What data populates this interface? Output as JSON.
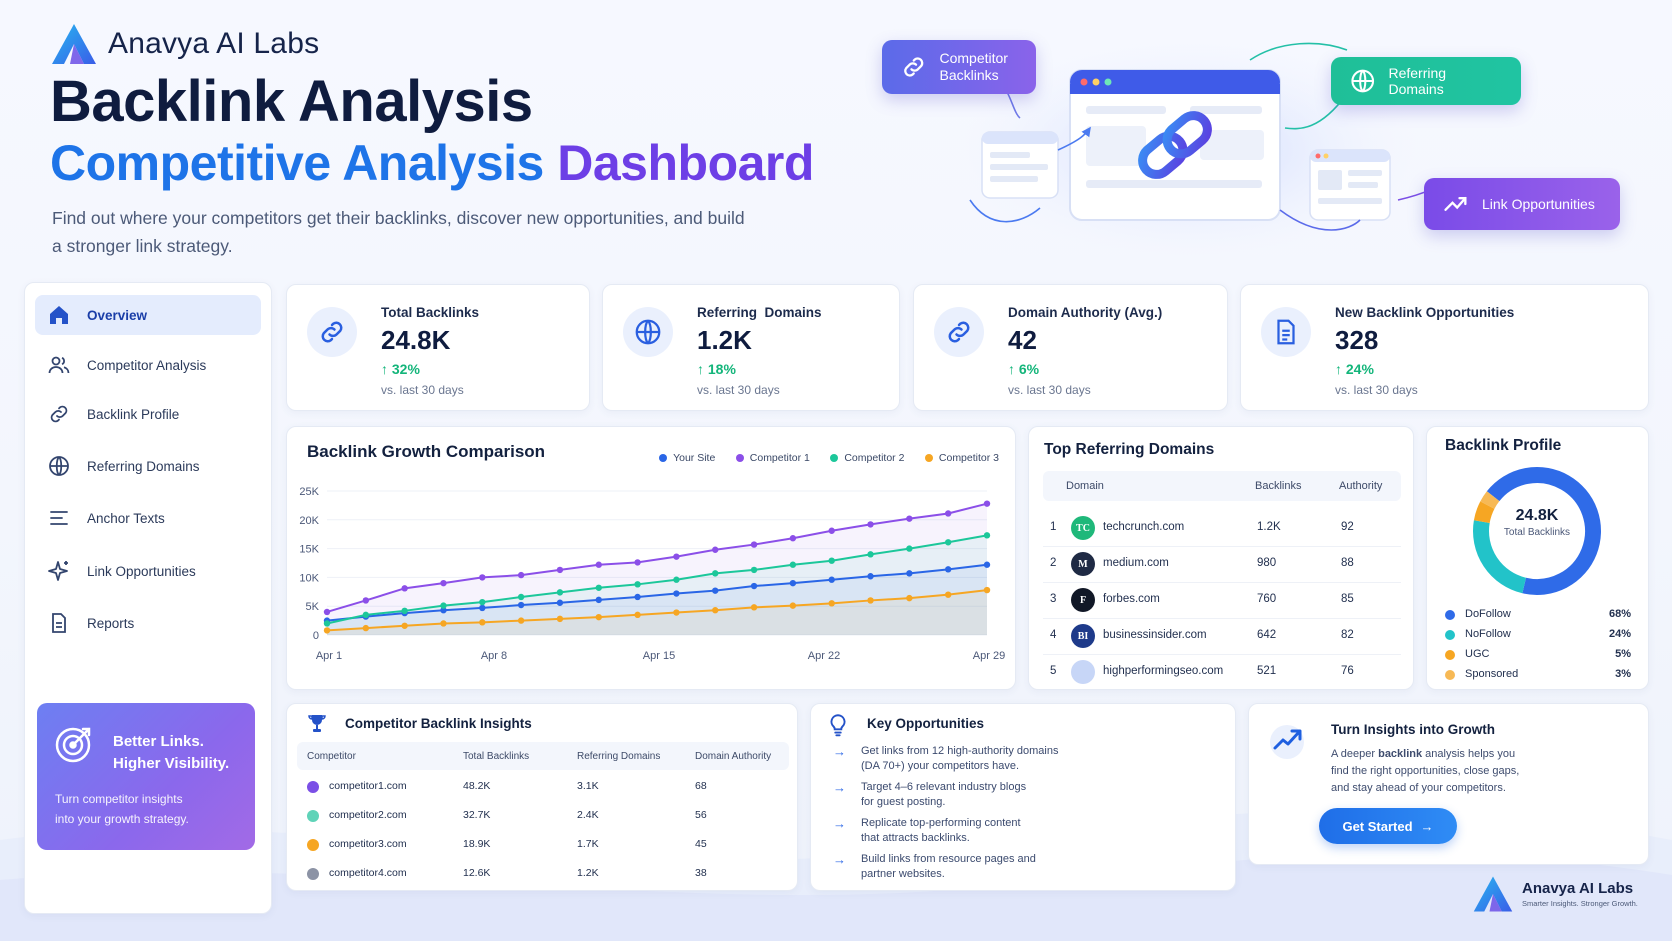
{
  "brand": {
    "name": "Anavya AI Labs"
  },
  "title": {
    "line1": "Backlink Analysis",
    "line2a": "Competitive Analysis",
    "line2b": "Dashboard"
  },
  "subtitle": "Find out where your competitors get their backlinks, discover new opportunities, and build a stronger link strategy.",
  "hero": {
    "badge_competitor": "Competitor Backlinks",
    "badge_referring": "Referring Domains",
    "badge_opportunities": "Link Opportunities"
  },
  "colors": {
    "blue": "#1e74e8",
    "purple": "#6d3fe6",
    "green": "#1cc79a",
    "orange": "#f6a623",
    "positive": "#13b57a"
  },
  "sidebar": {
    "items": [
      {
        "label": "Overview",
        "icon": "home-icon"
      },
      {
        "label": "Competitor Analysis",
        "icon": "users-icon"
      },
      {
        "label": "Backlink Profile",
        "icon": "link-icon"
      },
      {
        "label": "Referring Domains",
        "icon": "globe-icon"
      },
      {
        "label": "Anchor Texts",
        "icon": "text-lines-icon"
      },
      {
        "label": "Link Opportunities",
        "icon": "sparkle-icon"
      },
      {
        "label": "Reports",
        "icon": "document-icon"
      }
    ],
    "promo": {
      "title_line1": "Better Links.",
      "title_line2": "Higher Visibility.",
      "text_line1": "Turn competitor insights",
      "text_line2": "into your growth strategy."
    }
  },
  "stats": [
    {
      "label": "Total Backlinks",
      "value": "24.8K",
      "delta": "32%",
      "sub": "vs. last 30 days"
    },
    {
      "label": "Referring  Domains",
      "value": "1.2K",
      "delta": "18%",
      "sub": "vs. last 30 days"
    },
    {
      "label": "Domain Authority (Avg.)",
      "value": "42",
      "delta": "6%",
      "sub": "vs. last 30 days"
    },
    {
      "label": "New Backlink Opportunities",
      "value": "328",
      "delta": "24%",
      "sub": "vs. last 30 days"
    }
  ],
  "growth": {
    "title": "Backlink Growth Comparison",
    "legend": [
      "Your Site",
      "Competitor 1",
      "Competitor 2",
      "Competitor 3"
    ]
  },
  "chart_data": {
    "type": "line",
    "title": "Backlink Growth Comparison",
    "xlabel": "",
    "ylabel": "",
    "ylim": [
      0,
      25000
    ],
    "yticks": [
      "25K",
      "20K",
      "15K",
      "10K",
      "5K",
      "0"
    ],
    "xticks": [
      "Apr 1",
      "Apr 8",
      "Apr 15",
      "Apr 22",
      "Apr 29"
    ],
    "x": [
      1,
      2,
      3,
      4,
      5,
      6,
      7,
      8,
      9,
      10,
      11,
      12,
      13,
      14,
      15,
      16,
      17,
      18
    ],
    "series": [
      {
        "name": "Your Site",
        "color": "#2a66e6",
        "values": [
          2500,
          3200,
          3800,
          4300,
          4700,
          5200,
          5600,
          6100,
          6600,
          7200,
          7700,
          8500,
          9000,
          9600,
          10200,
          10700,
          11400,
          12200
        ]
      },
      {
        "name": "Competitor 1",
        "color": "#8b4fe8",
        "values": [
          4000,
          6000,
          8100,
          9000,
          10000,
          10400,
          11300,
          12200,
          12600,
          13600,
          14800,
          15700,
          16800,
          18100,
          19200,
          20200,
          21100,
          22800
        ]
      },
      {
        "name": "Competitor 2",
        "color": "#1cc79a",
        "values": [
          2000,
          3500,
          4200,
          5100,
          5700,
          6600,
          7400,
          8200,
          8800,
          9600,
          10700,
          11300,
          12200,
          12900,
          14000,
          15000,
          16100,
          17300
        ]
      },
      {
        "name": "Competitor 3",
        "color": "#f6a623",
        "values": [
          800,
          1200,
          1600,
          2000,
          2200,
          2500,
          2800,
          3100,
          3500,
          3900,
          4300,
          4800,
          5100,
          5500,
          6000,
          6400,
          7000,
          7800
        ]
      }
    ]
  },
  "top_domains": {
    "title": "Top Referring Domains",
    "headers": [
      "Domain",
      "Backlinks",
      "Authority"
    ],
    "rows": [
      {
        "rank": "1",
        "logo": "TC",
        "logo_color": "#1fb87a",
        "domain": "techcrunch.com",
        "backlinks": "1.2K",
        "authority": "92"
      },
      {
        "rank": "2",
        "logo": "M",
        "logo_color": "#1f2a44",
        "domain": "medium.com",
        "backlinks": "980",
        "authority": "88"
      },
      {
        "rank": "3",
        "logo": "F",
        "logo_color": "#111827",
        "domain": "forbes.com",
        "backlinks": "760",
        "authority": "85"
      },
      {
        "rank": "4",
        "logo": "BI",
        "logo_color": "#1e3a8a",
        "domain": "businessinsider.com",
        "backlinks": "642",
        "authority": "82"
      },
      {
        "rank": "5",
        "logo": "",
        "logo_color": "#c7d6f7",
        "domain": "highperformingseo.com",
        "backlinks": "521",
        "authority": "76"
      }
    ]
  },
  "profile": {
    "title": "Backlink Profile",
    "center_value": "24.8K",
    "center_label": "Total Backlinks",
    "segments": [
      {
        "label": "DoFollow",
        "pct": "68%",
        "value": 68,
        "color": "#2f6be8"
      },
      {
        "label": "NoFollow",
        "pct": "24%",
        "value": 24,
        "color": "#22c3c9"
      },
      {
        "label": "UGC",
        "pct": "5%",
        "value": 5,
        "color": "#f6a623"
      },
      {
        "label": "Sponsored",
        "pct": "3%",
        "value": 3,
        "color": "#f7b955"
      }
    ]
  },
  "insights": {
    "title": "Competitor Backlink Insights",
    "headers": [
      "Competitor",
      "Total Backlinks",
      "Referring Domains",
      "Domain Authority"
    ],
    "rows": [
      {
        "color": "#7b4fe6",
        "name": "competitor1.com",
        "backlinks": "48.2K",
        "domains": "3.1K",
        "authority": "68"
      },
      {
        "color": "#5fd3b8",
        "name": "competitor2.com",
        "backlinks": "32.7K",
        "domains": "2.4K",
        "authority": "56"
      },
      {
        "color": "#f6a623",
        "name": "competitor3.com",
        "backlinks": "18.9K",
        "domains": "1.7K",
        "authority": "45"
      },
      {
        "color": "#8c93a5",
        "name": "competitor4.com",
        "backlinks": "12.6K",
        "domains": "1.2K",
        "authority": "38"
      }
    ]
  },
  "key_opps": {
    "title": "Key Opportunities",
    "items": [
      {
        "line1": "Get links from 12 high-authority domains",
        "line2": "(DA 70+) your competitors have."
      },
      {
        "line1": "Target 4–6 relevant industry blogs",
        "line2": "for guest posting."
      },
      {
        "line1": "Replicate top-performing content",
        "line2": "that attracts backlinks."
      },
      {
        "line1": "Build links from resource pages and",
        "line2": "partner websites."
      }
    ]
  },
  "growth_cta": {
    "title": "Turn Insights into Growth",
    "text_pre": "A deeper ",
    "text_bold": "backlink",
    "text_post": " analysis helps you",
    "line2": "find the right opportunities, close gaps,",
    "line3": "and stay ahead of your competitors.",
    "button": "Get Started"
  },
  "footer": {
    "brand": "Anavya AI Labs",
    "tagline": "Smarter Insights. Stronger Growth."
  }
}
